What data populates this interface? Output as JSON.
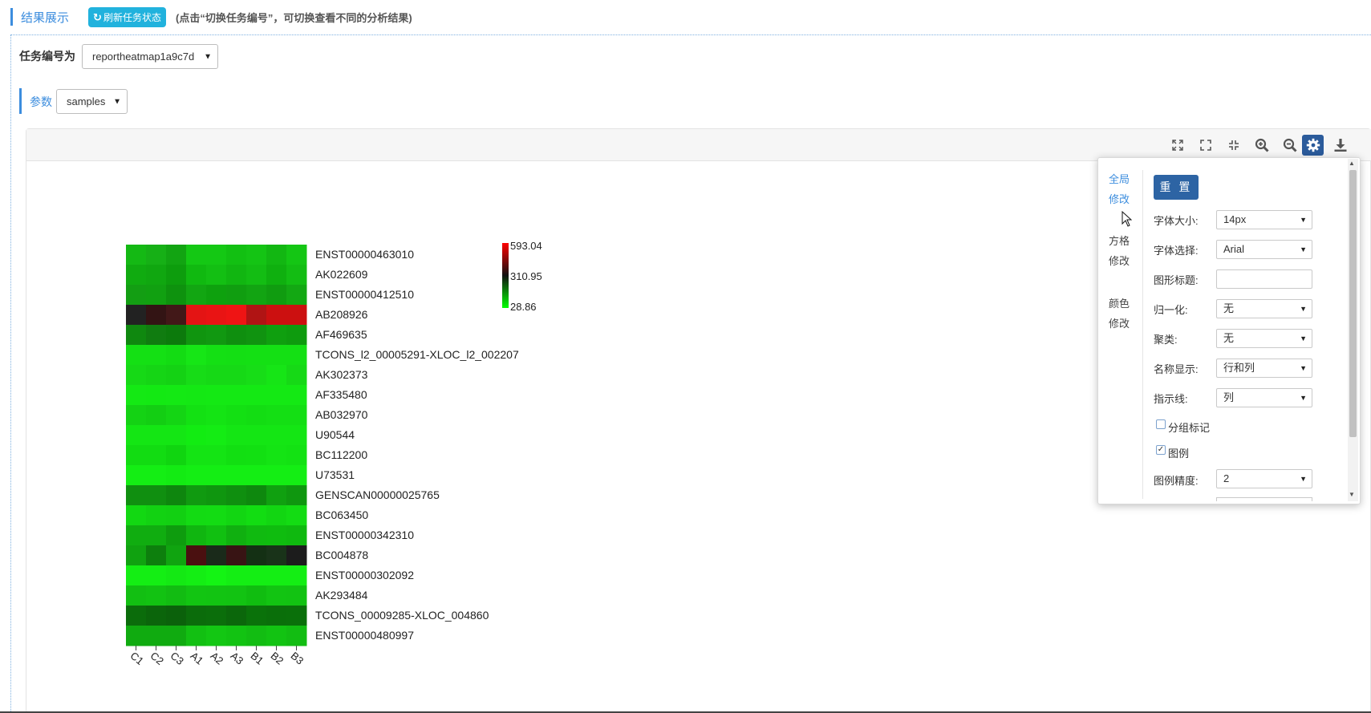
{
  "header": {
    "title": "结果展示",
    "refresh_label": "刷新任务状态",
    "hint": "(点击“切换任务编号”，可切换查看不同的分析结果)"
  },
  "task": {
    "label": "任务编号为",
    "selected": "reportheatmap1a9c7d"
  },
  "param": {
    "label": "参数",
    "selected": "samples"
  },
  "toolbar": {
    "icons": [
      "expand-width-icon",
      "fullscreen-icon",
      "shrink-icon",
      "zoom-in-icon",
      "zoom-out-icon",
      "gear-icon",
      "download-icon"
    ],
    "active": "gear-icon"
  },
  "heatmap": {
    "rows": [
      "ENST00000463010",
      "AK022609",
      "ENST00000412510",
      "AB208926",
      "AF469635",
      "TCONS_l2_00005291-XLOC_l2_002207",
      "AK302373",
      "AF335480",
      "AB032970",
      "U90544",
      "BC112200",
      "U73531",
      "GENSCAN00000025765",
      "BC063450",
      "ENST00000342310",
      "BC004878",
      "ENST00000302092",
      "AK293484",
      "TCONS_00009285-XLOC_004860",
      "ENST00000480997"
    ],
    "columns": [
      "C1",
      "C2",
      "C3",
      "A1",
      "A2",
      "A3",
      "B1",
      "B2",
      "B3"
    ],
    "colors": [
      [
        "#14b914",
        "#16b016",
        "#12a412",
        "#14c814",
        "#14c814",
        "#12c012",
        "#14c414",
        "#12b712",
        "#14c614"
      ],
      [
        "#10ab10",
        "#10a710",
        "#0d9d0d",
        "#10b910",
        "#13bf13",
        "#11b611",
        "#13bd13",
        "#0fb00f",
        "#13bd13"
      ],
      [
        "#139e13",
        "#11a011",
        "#0e920e",
        "#12a612",
        "#0ea10e",
        "#109e10",
        "#12a412",
        "#109c10",
        "#13a813"
      ],
      [
        "#222222",
        "#331414",
        "#421818",
        "#e41414",
        "#e91414",
        "#ef1414",
        "#b01414",
        "#cc1010",
        "#cc1010"
      ],
      [
        "#0f880f",
        "#107c10",
        "#0c7a0c",
        "#10950f",
        "#119811",
        "#0f8f0f",
        "#109310",
        "#0f9f0f",
        "#0e9b0e"
      ],
      [
        "#14e014",
        "#14e014",
        "#13dc13",
        "#16e616",
        "#14e014",
        "#14df14",
        "#14e014",
        "#14e014",
        "#14e014"
      ],
      [
        "#16d916",
        "#15d515",
        "#14d214",
        "#17dc17",
        "#16d916",
        "#16d916",
        "#17dd17",
        "#16e516",
        "#16d916"
      ],
      [
        "#14e914",
        "#13e913",
        "#14e914",
        "#14e814",
        "#14e914",
        "#14e914",
        "#14e914",
        "#14e914",
        "#14e914"
      ],
      [
        "#14d214",
        "#13ce13",
        "#14d514",
        "#13e113",
        "#14e414",
        "#13e013",
        "#13dd13",
        "#14df14",
        "#14df14"
      ],
      [
        "#14e614",
        "#14e614",
        "#14e614",
        "#12ec12",
        "#14ec14",
        "#14e614",
        "#14e614",
        "#14e614",
        "#14e614"
      ],
      [
        "#12dc12",
        "#12dc12",
        "#10d510",
        "#14e414",
        "#14e414",
        "#12df12",
        "#12e012",
        "#14e414",
        "#13e213"
      ],
      [
        "#14ee14",
        "#14ee14",
        "#13eb13",
        "#14ee14",
        "#14ee14",
        "#14ee14",
        "#14ee14",
        "#14ee14",
        "#14ee14"
      ],
      [
        "#108f10",
        "#108f10",
        "#0e860e",
        "#109a10",
        "#0f960f",
        "#0f8f0f",
        "#0e880e",
        "#10a010",
        "#0f970f"
      ],
      [
        "#12d812",
        "#12d212",
        "#12d012",
        "#13db13",
        "#13dc13",
        "#12d612",
        "#12dd12",
        "#12d612",
        "#13dc13"
      ],
      [
        "#10ad10",
        "#10ad10",
        "#0e9c0e",
        "#10b610",
        "#11c011",
        "#10b010",
        "#10ba10",
        "#0fbc0f",
        "#0fb90f"
      ],
      [
        "#10a210",
        "#0d7f0d",
        "#10a410",
        "#4a1010",
        "#1a2a1a",
        "#381414",
        "#143014",
        "#193319",
        "#1c1c1c"
      ],
      [
        "#14ee14",
        "#14ee14",
        "#14e914",
        "#14ee14",
        "#14f414",
        "#14ee14",
        "#14ee14",
        "#14ee14",
        "#14ee14"
      ],
      [
        "#12bf12",
        "#12c212",
        "#12bc12",
        "#12c512",
        "#12c412",
        "#12c312",
        "#10bd10",
        "#12c412",
        "#12c312"
      ],
      [
        "#0b6c0b",
        "#0b650b",
        "#0b610b",
        "#0b6c0b",
        "#0b6e0b",
        "#0b670b",
        "#0a720a",
        "#0a6f0a",
        "#0a700a"
      ],
      [
        "#10ab10",
        "#10ab10",
        "#10ab10",
        "#12c012",
        "#13c713",
        "#12c312",
        "#12bd12",
        "#12c312",
        "#12bd12"
      ]
    ]
  },
  "legend": {
    "max": "593.04",
    "mid": "310.95",
    "min": "28.86"
  },
  "settings": {
    "nav": [
      "全局修改",
      "方格修改",
      "颜色修改"
    ],
    "reset_label": "重 置",
    "font_size_label": "字体大小:",
    "font_size_value": "14px",
    "font_family_label": "字体选择:",
    "font_family_value": "Arial",
    "title_label": "图形标题:",
    "title_value": "",
    "normalize_label": "归一化:",
    "normalize_value": "无",
    "cluster_label": "聚类:",
    "cluster_value": "无",
    "name_display_label": "名称显示:",
    "name_display_value": "行和列",
    "guide_label": "指示线:",
    "guide_value": "列",
    "group_mark_label": "分组标记",
    "group_mark_checked": false,
    "legend_toggle_label": "图例",
    "legend_toggle_checked": true,
    "legend_precision_label": "图例精度:",
    "legend_precision_value": "2"
  }
}
